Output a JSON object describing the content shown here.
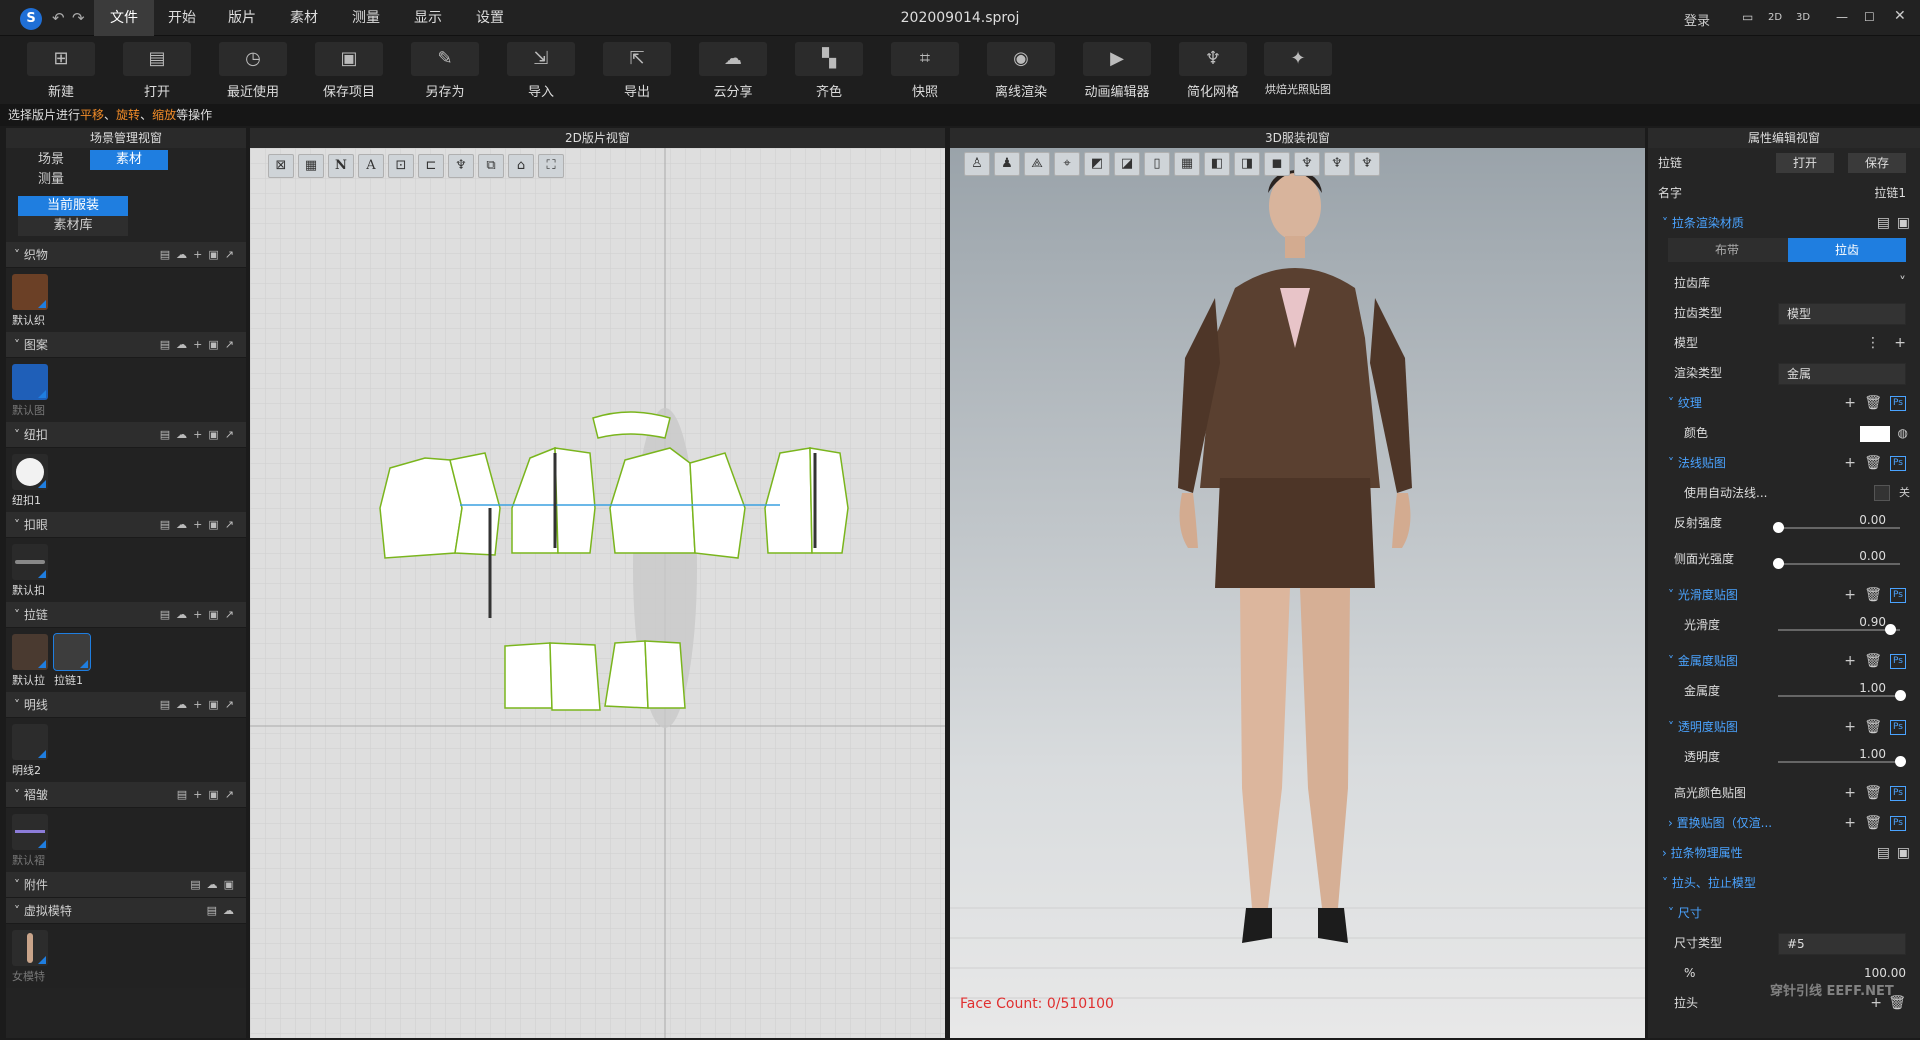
{
  "titlebar": {
    "file_name": "202009014.sproj",
    "menus": [
      "文件",
      "开始",
      "版片",
      "素材",
      "测量",
      "显示",
      "设置"
    ],
    "login": "登录",
    "view_2d": "2D",
    "view_3d": "3D"
  },
  "toolbar": {
    "items": [
      "新建",
      "打开",
      "最近使用",
      "保存项目",
      "另存为",
      "导入",
      "导出",
      "云分享",
      "齐色",
      "快照",
      "离线渲染",
      "动画编辑器",
      "简化网格",
      "烘焙光照贴图"
    ]
  },
  "hint": {
    "prefix": "选择版片进行",
    "pan": "平移",
    "sep1": "、",
    "rotate": "旋转",
    "sep2": "、",
    "scale": "缩放",
    "suffix": "等操作"
  },
  "left": {
    "title": "场景管理视窗",
    "tabs": [
      "场景",
      "素材",
      "测量"
    ],
    "subtabs": [
      "当前服装",
      "素材库"
    ],
    "sections": [
      {
        "name": "织物",
        "items": [
          "默认织"
        ]
      },
      {
        "name": "图案",
        "items": [
          "默认图"
        ]
      },
      {
        "name": "纽扣",
        "items": [
          "纽扣1"
        ]
      },
      {
        "name": "扣眼",
        "items": [
          "默认扣"
        ]
      },
      {
        "name": "拉链",
        "items": [
          "默认拉",
          "拉链1"
        ]
      },
      {
        "name": "明线",
        "items": [
          "明线2"
        ]
      },
      {
        "name": "褶皱",
        "items": [
          "默认褶"
        ]
      },
      {
        "name": "附件",
        "items": []
      },
      {
        "name": "虚拟模特",
        "items": [
          "女模特"
        ]
      }
    ]
  },
  "view2d": {
    "title": "2D版片视窗"
  },
  "view3d": {
    "title": "3D服装视窗",
    "face_count": "Face Count: 0/510100"
  },
  "right": {
    "title": "属性编辑视窗",
    "section_label": "拉链",
    "open": "打开",
    "save": "保存",
    "name_label": "名字",
    "name_value": "拉链1",
    "render_mat": "拉条渲染材质",
    "tab_a": "布带",
    "tab_b": "拉齿",
    "rows": {
      "lib": "拉齿库",
      "type": "拉齿类型",
      "type_val": "模型",
      "model": "模型",
      "render_type": "渲染类型",
      "render_val": "金属",
      "texture": "纹理",
      "color": "颜色",
      "normal": "法线贴图",
      "auto_normal": "使用自动法线...",
      "off": "关",
      "reflect": "反射强度",
      "reflect_v": "0.00",
      "side": "侧面光强度",
      "side_v": "0.00",
      "gloss_map": "光滑度贴图",
      "gloss": "光滑度",
      "gloss_v": "0.90",
      "metal_map": "金属度贴图",
      "metal": "金属度",
      "metal_v": "1.00",
      "trans_map": "透明度贴图",
      "trans": "透明度",
      "trans_v": "1.00",
      "spec_map": "高光颜色贴图",
      "disp_map": "置换贴图（仅渲...",
      "phys": "拉条物理属性",
      "head": "拉头、拉止模型",
      "size": "尺寸",
      "size_type": "尺寸类型",
      "size_val": "#5",
      "pct": "%",
      "pct_v": "100.00",
      "puller": "拉头"
    }
  },
  "watermark": "穿针引线 EEFF.NET"
}
